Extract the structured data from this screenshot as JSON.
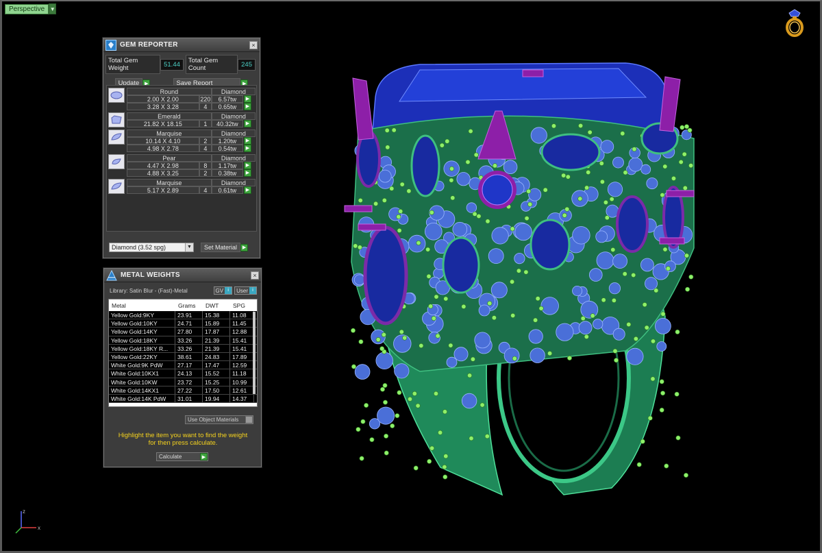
{
  "viewport": {
    "label": "Perspective",
    "axis_labels": {
      "x": "x",
      "z": "z"
    }
  },
  "gem_reporter": {
    "title": "GEM REPORTER",
    "total_weight_label": "Total Gem Weight",
    "total_weight_value": "51.44",
    "total_count_label": "Total Gem Count",
    "total_count_value": "245",
    "update_label": "Update",
    "save_report_label": "Save Report",
    "groups": [
      {
        "shape": "Round",
        "material": "Diamond",
        "icon": "round-gem-icon",
        "rows": [
          {
            "size": "2.00 X 2.00",
            "count": "220",
            "weight": "6.57tw"
          },
          {
            "size": "3.28 X 3.28",
            "count": "4",
            "weight": "0.65tw"
          }
        ]
      },
      {
        "shape": "Emerald",
        "material": "Diamond",
        "icon": "emerald-gem-icon",
        "rows": [
          {
            "size": "21.82 X 18.15",
            "count": "1",
            "weight": "40.32tw"
          }
        ]
      },
      {
        "shape": "Marquise",
        "material": "Diamond",
        "icon": "marquise-gem-icon",
        "rows": [
          {
            "size": "10.14 X 4.10",
            "count": "2",
            "weight": "1.20tw"
          },
          {
            "size": "4.98 X 2.78",
            "count": "4",
            "weight": "0.54tw"
          }
        ]
      },
      {
        "shape": "Pear",
        "material": "Diamond",
        "icon": "pear-gem-icon",
        "rows": [
          {
            "size": "4.47 X 2.98",
            "count": "8",
            "weight": "1.17tw"
          },
          {
            "size": "4.88 X 3.25",
            "count": "2",
            "weight": "0.38tw"
          }
        ]
      },
      {
        "shape": "Marquise",
        "material": "Diamond",
        "icon": "marquise-gem-icon",
        "rows": [
          {
            "size": "5.17 X 2.89",
            "count": "4",
            "weight": "0.61tw"
          }
        ]
      }
    ],
    "material_select": "Diamond    (3.52 spg)",
    "set_material_label": "Set Material"
  },
  "metal_weights": {
    "title": "METAL WEIGHTS",
    "library_label": "Library: Satin Blur - (Fast)-Metal",
    "gv_label": "GV",
    "user_label": "User",
    "columns": [
      "Metal",
      "Grams",
      "DWT",
      "SPG"
    ],
    "rows": [
      [
        "Yellow Gold:9KY",
        "23.91",
        "15.38",
        "11.08"
      ],
      [
        "Yellow Gold:10KY",
        "24.71",
        "15.89",
        "11.45"
      ],
      [
        "Yellow Gold:14KY",
        "27.80",
        "17.87",
        "12.88"
      ],
      [
        "Yellow Gold:18KY",
        "33.26",
        "21.39",
        "15.41"
      ],
      [
        "Yellow Gold:18KY R...",
        "33.26",
        "21.39",
        "15.41"
      ],
      [
        "Yellow Gold:22KY",
        "38.61",
        "24.83",
        "17.89"
      ],
      [
        "White Gold:9K PdW",
        "27.17",
        "17.47",
        "12.59"
      ],
      [
        "White Gold:10KX1",
        "24.13",
        "15.52",
        "11.18"
      ],
      [
        "White Gold:10KW",
        "23.72",
        "15.25",
        "10.99"
      ],
      [
        "White Gold:14KX1",
        "27.22",
        "17.50",
        "12.61"
      ],
      [
        "White Gold:14K PdW",
        "31.01",
        "19.94",
        "14.37"
      ]
    ],
    "use_object_materials_label": "Use Object Materials",
    "hint_line1": "Highlight the item you want to find the weight",
    "hint_line2": "for then press calculate.",
    "calculate_label": "Calculate"
  },
  "colors": {
    "green_button": "#3ea33e",
    "value_cyan": "#4bd0c6",
    "hint_yellow": "#f5d21e",
    "gem_blue": "#2a3fc4",
    "prong_purple": "#8d1fa8",
    "metal_green": "#1f8a5a"
  }
}
